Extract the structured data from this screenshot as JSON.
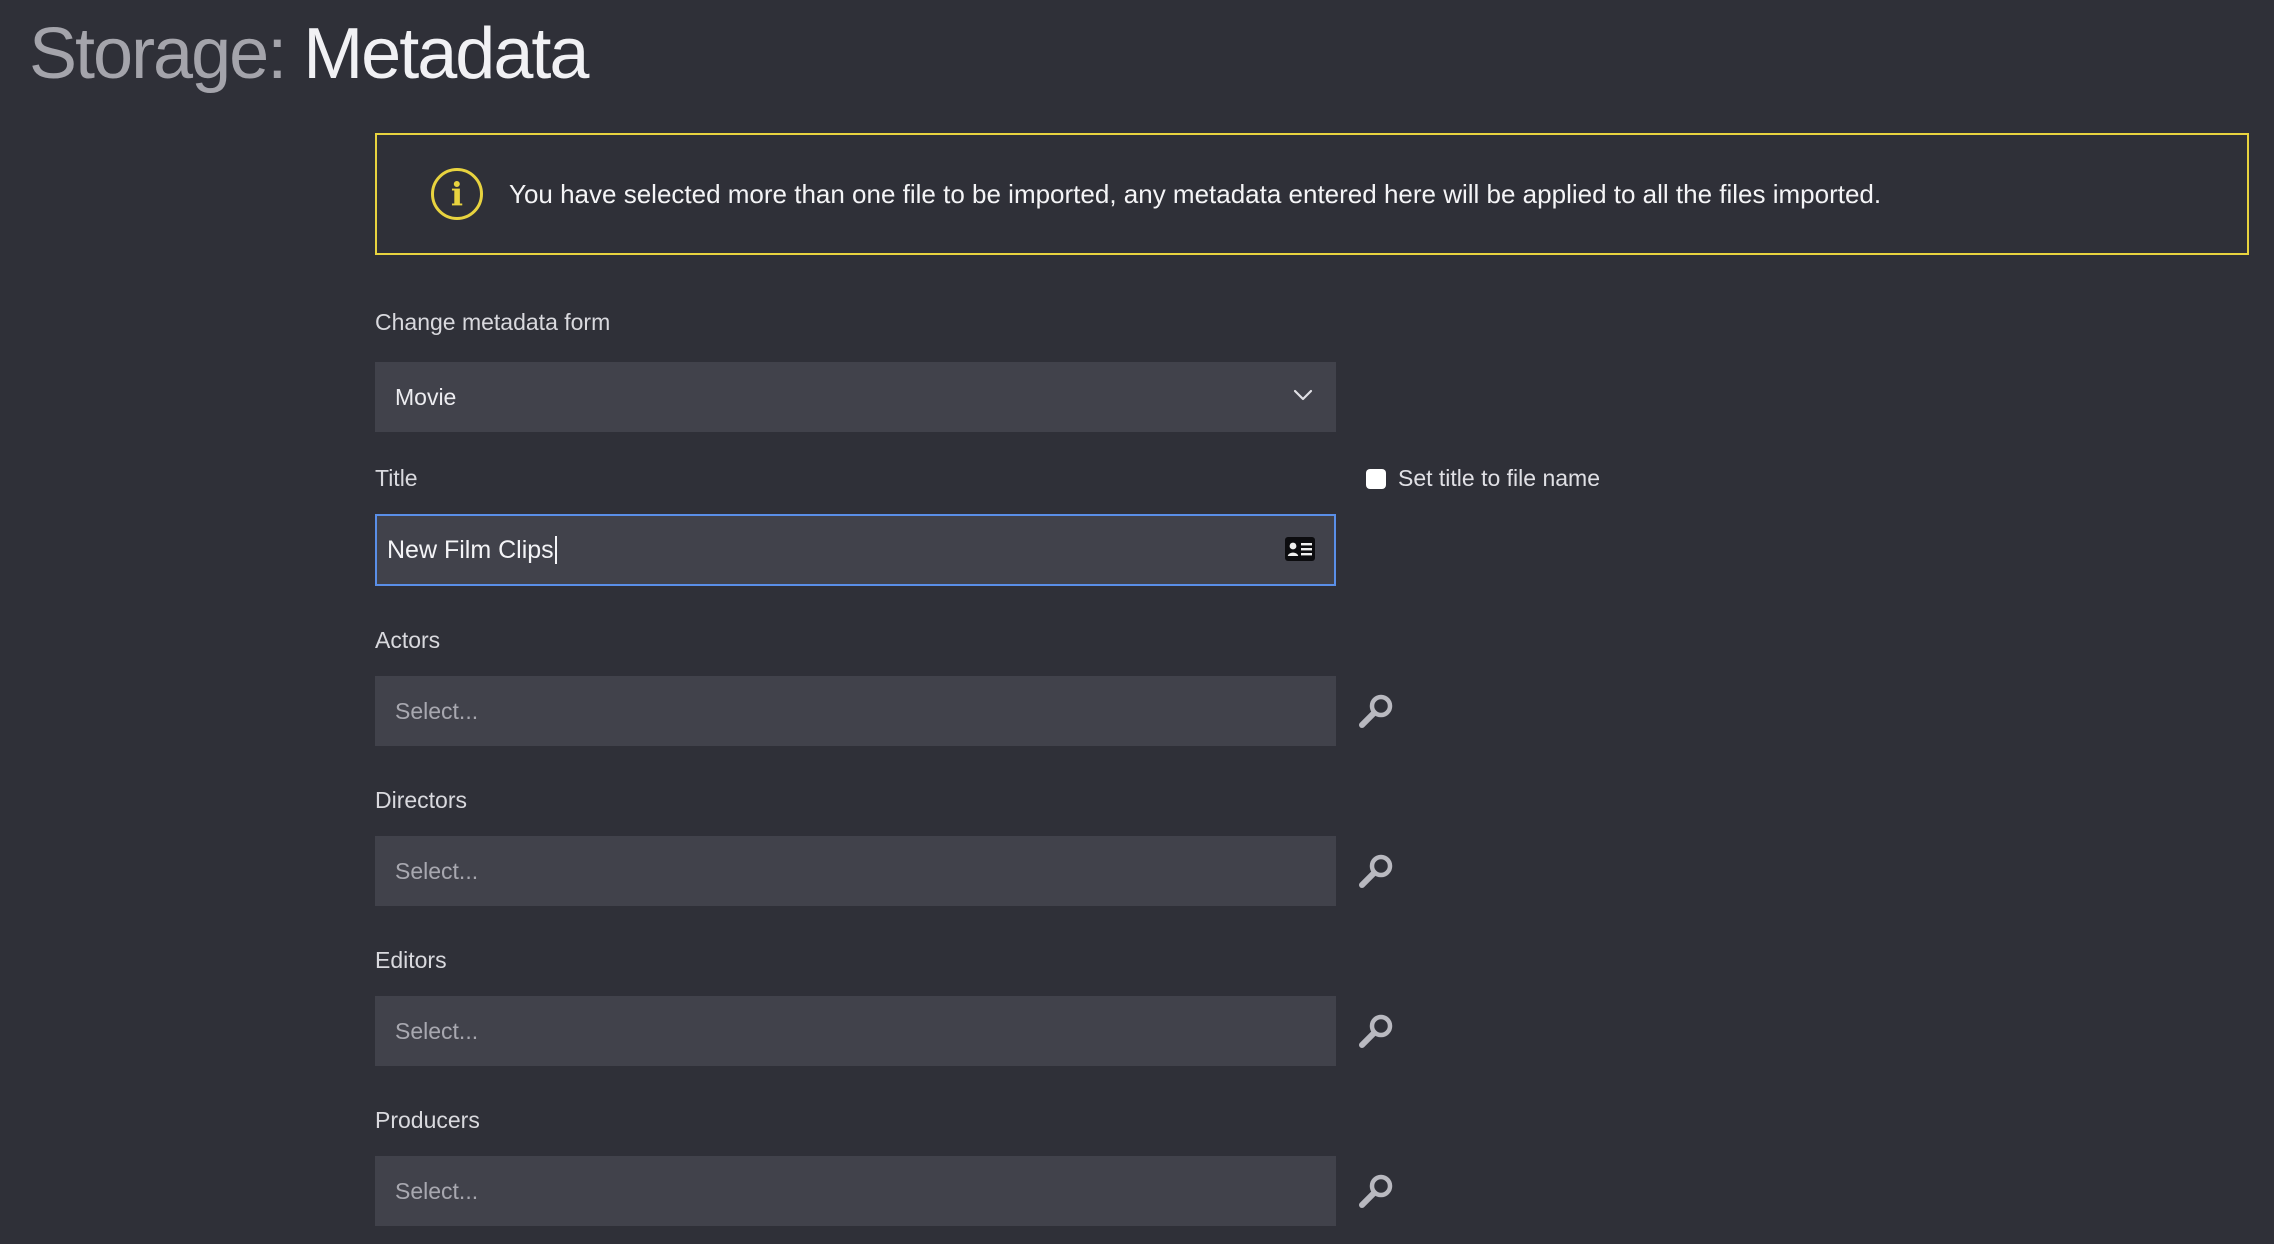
{
  "header": {
    "title_prefix": "Storage",
    "title_separator": ":",
    "title_main": "Metadata"
  },
  "notice": {
    "icon": "info-icon",
    "icon_glyph": "i",
    "text": "You have selected more than one file to be imported, any metadata entered here will be applied to all the files imported.",
    "border_color": "#e8d33f"
  },
  "form_selector": {
    "label": "Change metadata form",
    "selected": "Movie"
  },
  "title_field": {
    "label": "Title",
    "value": "New Film Clips",
    "icon": "contact-card-icon",
    "focus_color": "#5a8fe8"
  },
  "set_title_checkbox": {
    "label": "Set title to file name",
    "checked": false
  },
  "fields": [
    {
      "label": "Actors",
      "placeholder": "Select...",
      "icon": "search-icon"
    },
    {
      "label": "Directors",
      "placeholder": "Select...",
      "icon": "search-icon"
    },
    {
      "label": "Editors",
      "placeholder": "Select...",
      "icon": "search-icon"
    },
    {
      "label": "Producers",
      "placeholder": "Select...",
      "icon": "search-icon"
    }
  ],
  "colors": {
    "background": "#2f3038",
    "field_background": "#41424b"
  }
}
